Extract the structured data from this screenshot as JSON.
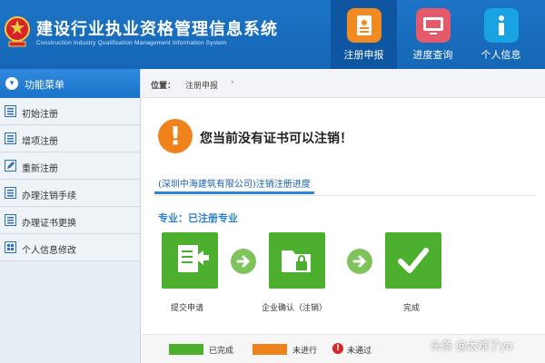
{
  "header": {
    "title": "建设行业执业资格管理信息系统",
    "subtitle": "Construction Industry Qualification Management Information System",
    "nav": [
      {
        "label": "注册申报",
        "icon": "certificate-icon",
        "active": true
      },
      {
        "label": "进度查询",
        "icon": "monitor-icon",
        "active": false
      },
      {
        "label": "个人信息",
        "icon": "info-icon",
        "active": false
      }
    ]
  },
  "sidebar": {
    "heading": "功能菜单",
    "items": [
      {
        "label": "初始注册",
        "icon": "list-icon"
      },
      {
        "label": "增项注册",
        "icon": "list-icon"
      },
      {
        "label": "重新注册",
        "icon": "edit-icon"
      },
      {
        "label": "办理注销手续",
        "icon": "list-icon"
      },
      {
        "label": "办理证书更换",
        "icon": "list-icon"
      },
      {
        "label": "个人信息修改",
        "icon": "grid-icon"
      }
    ]
  },
  "breadcrumb": {
    "key": "位置：",
    "value": "注册申报",
    "sep": "›"
  },
  "notice": {
    "mark": "!",
    "text": "您当前没有证书可以注销！"
  },
  "tab": {
    "label": "(深圳中海建筑有限公司)注销注册进度"
  },
  "section": {
    "label": "专业：已注册专业"
  },
  "steps": [
    {
      "label": "提交申请"
    },
    {
      "label": "企业确认（注销）"
    },
    {
      "label": "完成"
    }
  ],
  "legend": [
    {
      "label": "已完成",
      "color": "#4caf2e"
    },
    {
      "label": "未进行",
      "color": "#f0821c"
    },
    {
      "label": "未通过",
      "mark": "!"
    }
  ],
  "colors": {
    "header": "#1d74c6",
    "done": "#4caf2e",
    "pending": "#f0821c",
    "failed": "#d9262a"
  },
  "watermark": "头条 @太难了ya"
}
